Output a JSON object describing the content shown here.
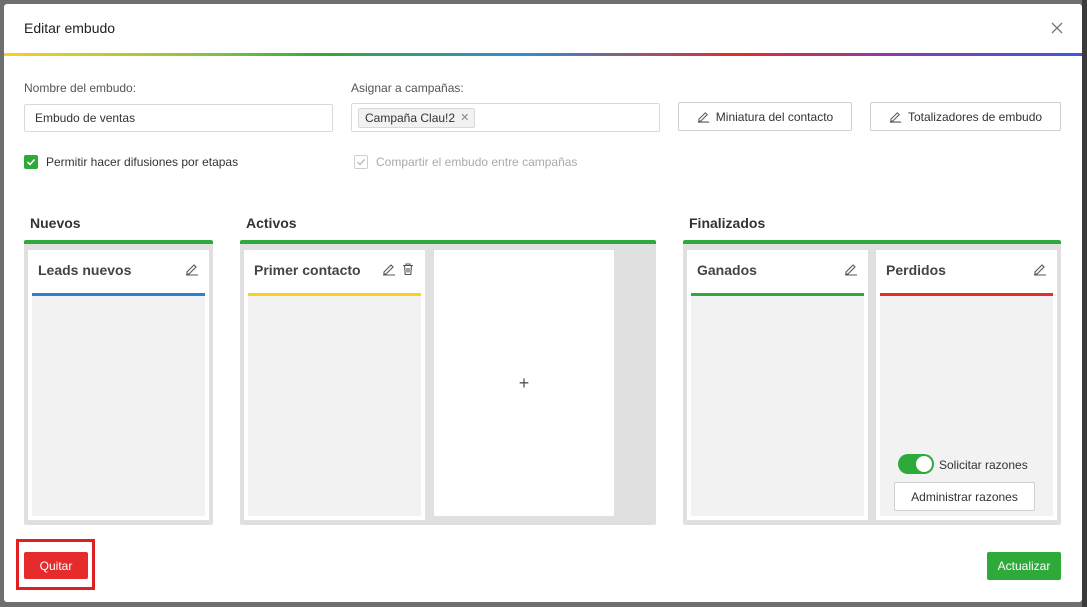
{
  "modal": {
    "title": "Editar embudo",
    "close_icon": "close-icon"
  },
  "form": {
    "funnel_name_label": "Nombre del embudo",
    "funnel_name_value": "Embudo de ventas",
    "campaigns_label": "Asignar a campañas",
    "campaign_tags": [
      "Campaña Clau!2"
    ],
    "contact_thumbnail_button": "Miniatura del contacto",
    "funnel_totals_button": "Totalizadores de embudo",
    "allow_broadcast_label": "Permitir hacer difusiones por etapas",
    "allow_broadcast_checked": true,
    "share_funnel_label": "Compartir el embudo entre campañas",
    "share_funnel_checked": true,
    "share_funnel_disabled": true
  },
  "groups": {
    "nuevos": {
      "title": "Nuevos",
      "stages": [
        {
          "name": "Leads nuevos",
          "color": "#2b7fd6"
        }
      ]
    },
    "activos": {
      "title": "Activos",
      "stages": [
        {
          "name": "Primer contacto",
          "color": "#f7d21e"
        }
      ],
      "add_stage_symbol": "+"
    },
    "finalizados": {
      "title": "Finalizados",
      "stages": [
        {
          "name": "Ganados",
          "color": "#2eaa3a"
        },
        {
          "name": "Perdidos",
          "color": "#e52b2b"
        }
      ],
      "request_reasons_label": "Solicitar razones",
      "request_reasons_on": true,
      "manage_reasons_button": "Administrar razones"
    }
  },
  "footer": {
    "quit_button": "Quitar",
    "update_button": "Actualizar"
  },
  "colors": {
    "accent_green": "#2eaa3a",
    "danger_red": "#e52b2b"
  }
}
